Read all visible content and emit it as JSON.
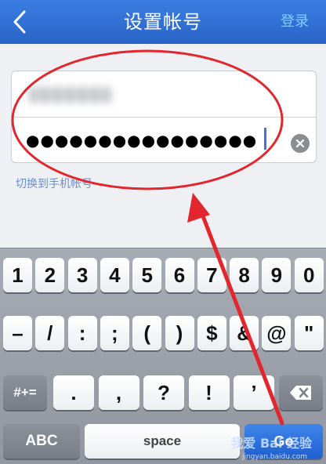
{
  "navbar": {
    "title": "设置帐号",
    "login_label": "登录",
    "back_icon": "chevron-left-icon",
    "colors": {
      "bar": "#2f6fd6",
      "title": "#ffffff",
      "login": "#7fd0ff"
    }
  },
  "form": {
    "account_value": "●●●●●●●●●",
    "password_value": "●●●●●●●●●●●●●●●●",
    "clear_icon": "clear-circle-icon",
    "switch_link": "切换到手机帐号"
  },
  "keyboard": {
    "row1": [
      "1",
      "2",
      "3",
      "4",
      "5",
      "6",
      "7",
      "8",
      "9",
      "0"
    ],
    "row2": [
      "–",
      "/",
      ":",
      ";",
      "(",
      ")",
      "$",
      "&",
      "@",
      "\""
    ],
    "row3": [
      ".",
      ",",
      "?",
      "!",
      "’"
    ],
    "symbols_toggle": "#+=",
    "backspace_icon": "backspace-icon",
    "abc_label": "ABC",
    "space_label": "space",
    "go_label": "Go"
  },
  "watermark": {
    "text": "我爱 Bai 经验",
    "sub": "jingyan.baidu.com"
  },
  "annotation_color": "#e3262d"
}
